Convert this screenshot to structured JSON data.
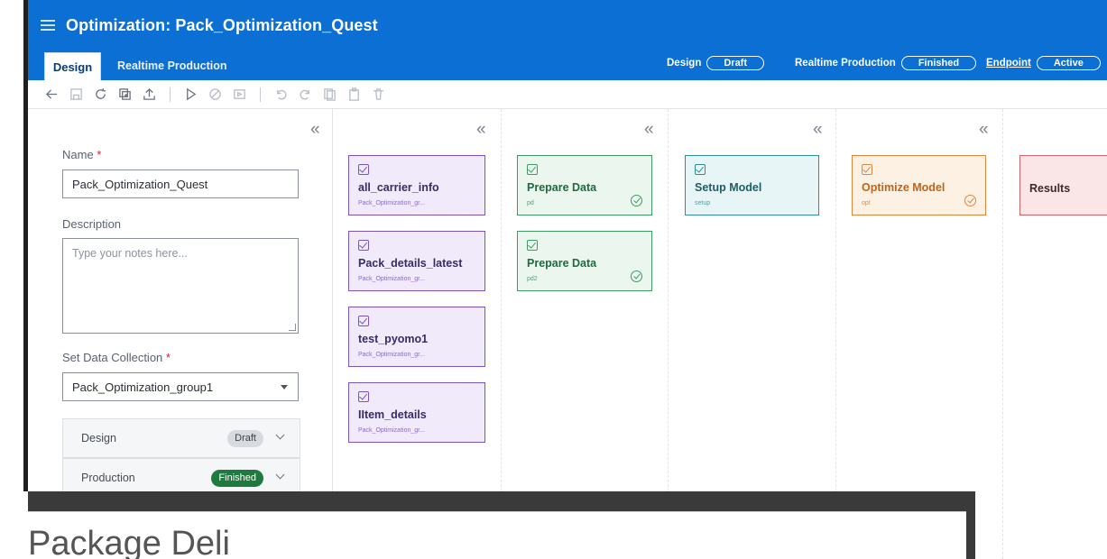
{
  "header": {
    "title": "Optimization: Pack_Optimization_Quest",
    "tabs": {
      "design": "Design",
      "realtime": "Realtime Production"
    },
    "status": {
      "design_label": "Design",
      "design_value": "Draft",
      "realtime_label": "Realtime Production",
      "realtime_value": "Finished",
      "endpoint_label": "Endpoint",
      "endpoint_value": "Active"
    }
  },
  "toolbar": {
    "icons": [
      "back-icon",
      "save-icon",
      "refresh-icon",
      "add-icon",
      "upload-icon",
      "run-icon",
      "stop-icon",
      "deploy-icon",
      "undo-icon",
      "redo-icon",
      "copy-icon",
      "paste-icon",
      "delete-icon"
    ]
  },
  "left_panel": {
    "name_label": "Name",
    "name_value": "Pack_Optimization_Quest",
    "description_label": "Description",
    "description_placeholder": "Type your notes here...",
    "collection_label": "Set Data Collection",
    "collection_value": "Pack_Optimization_group1",
    "design_status_label": "Design",
    "design_status_badge": "Draft",
    "production_status_label": "Production",
    "production_status_badge": "Finished",
    "collapse_glyph": "«"
  },
  "columns": {
    "data": [
      {
        "title": "all_carrier_info",
        "sub": "Pack_Optimization_gr..."
      },
      {
        "title": "Pack_details_latest",
        "sub": "Pack_Optimization_gr..."
      },
      {
        "title": "test_pyomo1",
        "sub": "Pack_Optimization_gr..."
      },
      {
        "title": "IItem_details",
        "sub": "Pack_Optimization_gr..."
      }
    ],
    "prepare": [
      {
        "title": "Prepare Data",
        "sub": "pd"
      },
      {
        "title": "Prepare Data",
        "sub": "pd2"
      }
    ],
    "setup": {
      "title": "Setup Model",
      "sub": "setup"
    },
    "optimize": {
      "title": "Optimize Model",
      "sub": "opt"
    },
    "results": {
      "title": "Results"
    }
  },
  "overlay": {
    "title": "Package Deli"
  },
  "colors": {
    "header_bg": "#0b6fd4",
    "data_node": "#7b54c0",
    "prepare_node": "#3d9c63",
    "setup_node": "#2f8e96",
    "optimize_node": "#e0873c",
    "results_node": "#d3636b",
    "draft_badge": "#d7dade",
    "finished_badge": "#1f7a3f"
  }
}
